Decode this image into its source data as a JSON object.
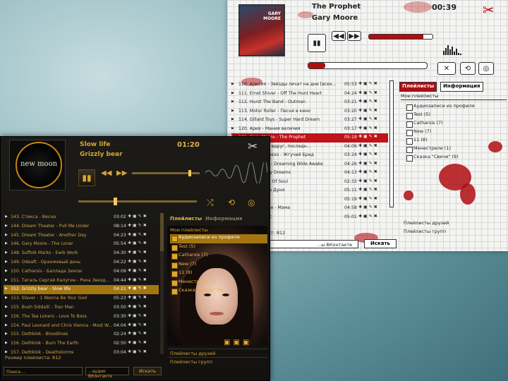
{
  "back_player": {
    "cover_text": "GARY\nMOORE",
    "title": "The Prophet",
    "artist": "Gary Moore",
    "time": "00:39",
    "tracks": [
      {
        "name": "110. Алисия - Звёзды лечат на дне [всех...",
        "time": "05:53"
      },
      {
        "name": "111. Ernst Shiver - Off The Hunt Heart",
        "time": "04:24"
      },
      {
        "name": "112. Hurst The Band - Outman",
        "time": "03:21"
      },
      {
        "name": "113. Motor Roller - Песня в кино",
        "time": "03:20"
      },
      {
        "name": "114. Gillard Toys - Super Hard Dream",
        "time": "03:27"
      },
      {
        "name": "120. Ария - Мания величия",
        "time": "03:17"
      },
      {
        "name": "121. Gary Moore - The Prophet",
        "time": "05:19",
        "selected": true
      },
      {
        "name": "122. ...ия, где вдруг, последн...",
        "time": "04:09"
      },
      {
        "name": "123. Строю Гнезо - Жгучий Бред",
        "time": "03:24"
      },
      {
        "name": "124. ...the Fall - Dreaming Wide Awake",
        "time": "04:26"
      },
      {
        "name": "125. ... - Freaky Dreams",
        "time": "04:13"
      },
      {
        "name": "126. ...ean Full Of Soul",
        "time": "02:33"
      },
      {
        "name": "127. ...т - Баба Дуня",
        "time": "05:11"
      },
      {
        "name": "128. ...обить",
        "time": "05:19"
      },
      {
        "name": "129. ...ималисе - Мама",
        "time": "04:58"
      },
      {
        "name": "130. ...т - Янис",
        "time": "05:01"
      }
    ],
    "tab_playlists": "Плейлисты",
    "tab_info": "Информация",
    "my_playlists_header": "Мои плейлисты",
    "playlists": [
      "Аудиозаписи из профиля",
      "Test (5)",
      "Catharsis (7)",
      "New (7)",
      "11 (8)",
      "Менестрели (1)",
      "Сказка \"Свечи\" (9)"
    ],
    "friends_playlists": "Плейлисты друзей",
    "groups_playlists": "Плейлисты групп",
    "playlist_size": "...ст: 812",
    "search_scope": "...ы ВКонтакте",
    "search_button": "Искать",
    "accent": "#b00d12"
  },
  "front_player": {
    "cover_text": "new moon",
    "title": "Slow life",
    "artist": "Grizzly bear",
    "time": "01:20",
    "tracks": [
      {
        "name": "143. Стикса - Весна",
        "time": "03:02"
      },
      {
        "name": "144. Dream Theater - Pull Me Under",
        "time": "08:14"
      },
      {
        "name": "145. Dream Theater - Another Day",
        "time": "04:23"
      },
      {
        "name": "146. Gary Moore - The Loner",
        "time": "05:54"
      },
      {
        "name": "148. Suffolk Marks - Ewik Work",
        "time": "04:30"
      },
      {
        "name": "149. Оdeaft - Оранжевый день",
        "time": "04:22"
      },
      {
        "name": "150. Catharsis - Баллада Земли",
        "time": "04:09"
      },
      {
        "name": "151. Тигаль Сергей Калугин - Река Звезд...",
        "time": "04:44"
      },
      {
        "name": "152. Grizzly bear - Slow life",
        "time": "04:21",
        "selected": true
      },
      {
        "name": "153. Slaver - 1 Wanna Be Your God",
        "time": "05:23"
      },
      {
        "name": "155. Bush Siddalli - Tran Man",
        "time": "03:50"
      },
      {
        "name": "156. The Tea Loners - Love To Boss",
        "time": "03:30"
      },
      {
        "name": "154. Paul Leonard and Chris Vienna - Most W...",
        "time": "04:04"
      },
      {
        "name": "155. Dethklok - Bloodlines",
        "time": "02:24"
      },
      {
        "name": "156. Dethklok - Burn The Earth",
        "time": "02:50"
      },
      {
        "name": "157. Dethklok - Deathstorms",
        "time": "03:04"
      }
    ],
    "tab_playlists": "Плейлисты",
    "tab_info": "Информация",
    "my_playlists_header": "Мои плейлисты",
    "playlists": [
      "Аудиозаписи из профиля",
      "Test (5)",
      "Catharsis (7)",
      "New (7)",
      "11 (8)",
      "Менестрели (1)",
      "Сказка \"Свечи\" (9)"
    ],
    "friends_playlists": "Плейлисты друзей",
    "groups_playlists": "Плейлисты групп",
    "playlist_size": "Размер плейлиста: 812",
    "search_placeholder": "Поиск...",
    "search_scope": "...аудио ВКонтакте",
    "search_button": "Искать",
    "accent": "#d9a532"
  }
}
